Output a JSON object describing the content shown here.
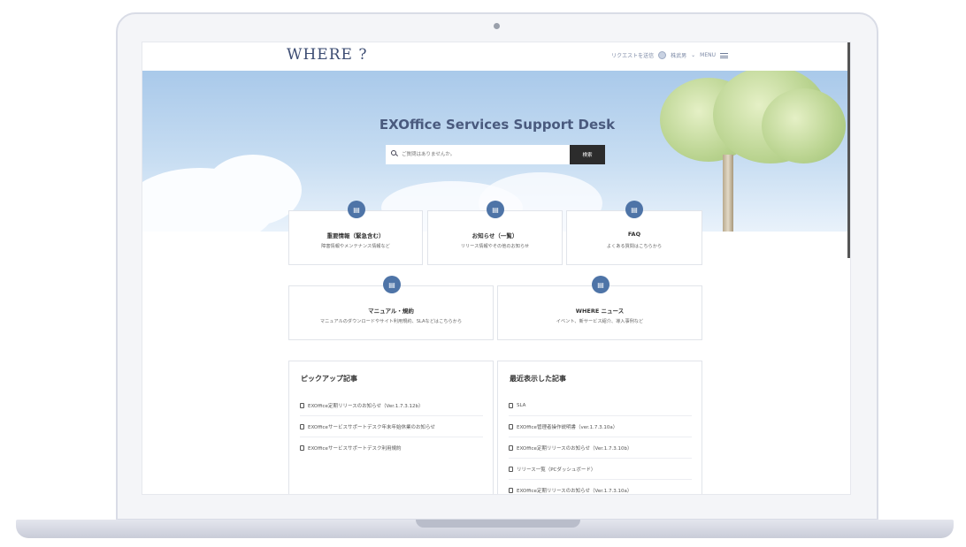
{
  "header": {
    "logo": "WHERE ?",
    "request_label": "リクエストを送信",
    "user_label": "株武男",
    "menu_label": "MENU"
  },
  "hero": {
    "title": "EXOffice Services Support Desk",
    "search_placeholder": "ご質問はありませんか。",
    "search_button": "検索"
  },
  "categories": [
    {
      "title": "重要情報（緊急含む）",
      "desc": "障害情報やメンテナンス情報など",
      "icon": "document-stack-icon"
    },
    {
      "title": "お知らせ（一覧）",
      "desc": "リリース情報やその他のお知らせ",
      "icon": "document-stack-icon"
    },
    {
      "title": "FAQ",
      "desc": "よくある質問はこちらから",
      "icon": "document-stack-icon"
    },
    {
      "title": "マニュアル・規約",
      "desc": "マニュアルのダウンロードやサイト利用規約、SLAなどはこちらから",
      "icon": "document-stack-icon"
    },
    {
      "title": "WHERE ニュース",
      "desc": "イベント、新サービス紹介、導入事例など",
      "icon": "document-stack-icon"
    }
  ],
  "pickup": {
    "title": "ピックアップ記事",
    "items": [
      "EXOffice定期リリースのお知らせ（Ver.1.7.3.12b）",
      "EXOfficeサービスサポートデスク年末年始休業のお知らせ",
      "EXOfficeサービスサポートデスク利用規約"
    ]
  },
  "recent": {
    "title": "最近表示した記事",
    "items": [
      "SLA",
      "EXOffice管理者操作説明書（ver.1.7.3.10a）",
      "EXOffice定期リリースのお知らせ（Ver.1.7.3.10b）",
      "リリース一覧（PCダッシュボード）",
      "EXOffice定期リリースのお知らせ（Ver.1.7.3.10a）"
    ]
  },
  "colors": {
    "accent": "#4e74a7",
    "logo": "#3d4d73",
    "search_button": "#2c2c2c"
  }
}
